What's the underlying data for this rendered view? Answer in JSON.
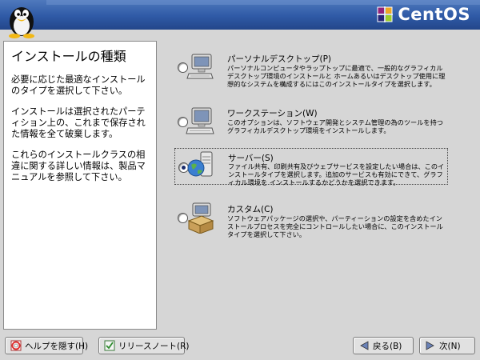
{
  "header": {
    "brand": "CentOS"
  },
  "help": {
    "title": "インストールの種類",
    "paragraphs": [
      "必要に応じた最適なインストールのタイプを選択して下さい。",
      "インストールは選択されたパーティション上の、これまで保存された情報を全て破棄します。",
      "これらのインストールクラスの相違に関する詳しい情報は、製品マニュアルを参照して下さい。"
    ]
  },
  "options": [
    {
      "title": "パーソナルデスクトップ(P)",
      "description": "パーソナルコンピュータやラップトップに最適で、一般的なグラフィカルデスクトップ環境のインストールと ホームあるいはデスクトップ使用に理想的なシステムを構成するにはこのインストールタイプを選択します。",
      "selected": false
    },
    {
      "title": "ワークステーション(W)",
      "description": "このオプションは、ソフトウェア開発とシステム管理の為のツールを持つグラフィカルデスクトップ環境をインストールします。",
      "selected": false
    },
    {
      "title": "サーバー(S)",
      "description": "ファイル共有、印刷共有及びウェブサービスを設定したい場合は、このインストールタイプを選択します。追加のサービスも有効にできて、グラフィカル環境を インストールするかどうかを選択できます。",
      "selected": true
    },
    {
      "title": "カスタム(C)",
      "description": "ソフトウェアパッケージの選択や、パーティーションの設定を含めたインストールプロセスを完全にコントロールしたい場合に、このインストールタイプを選択して下さい。",
      "selected": false
    }
  ],
  "buttons": {
    "hide_help": "ヘルプを隠す(H)",
    "release_notes": "リリースノート(R)",
    "back": "戻る(B)",
    "next": "次(N)"
  },
  "icons": {
    "personal_desktop": "desktop-computer-icon",
    "workstation": "workstation-icon",
    "server": "server-globe-icon",
    "custom": "custom-package-icon"
  },
  "colors": {
    "header_blue": "#2f5aa6",
    "background": "#d6d6d6",
    "radio_dot": "#1a2c6a"
  }
}
